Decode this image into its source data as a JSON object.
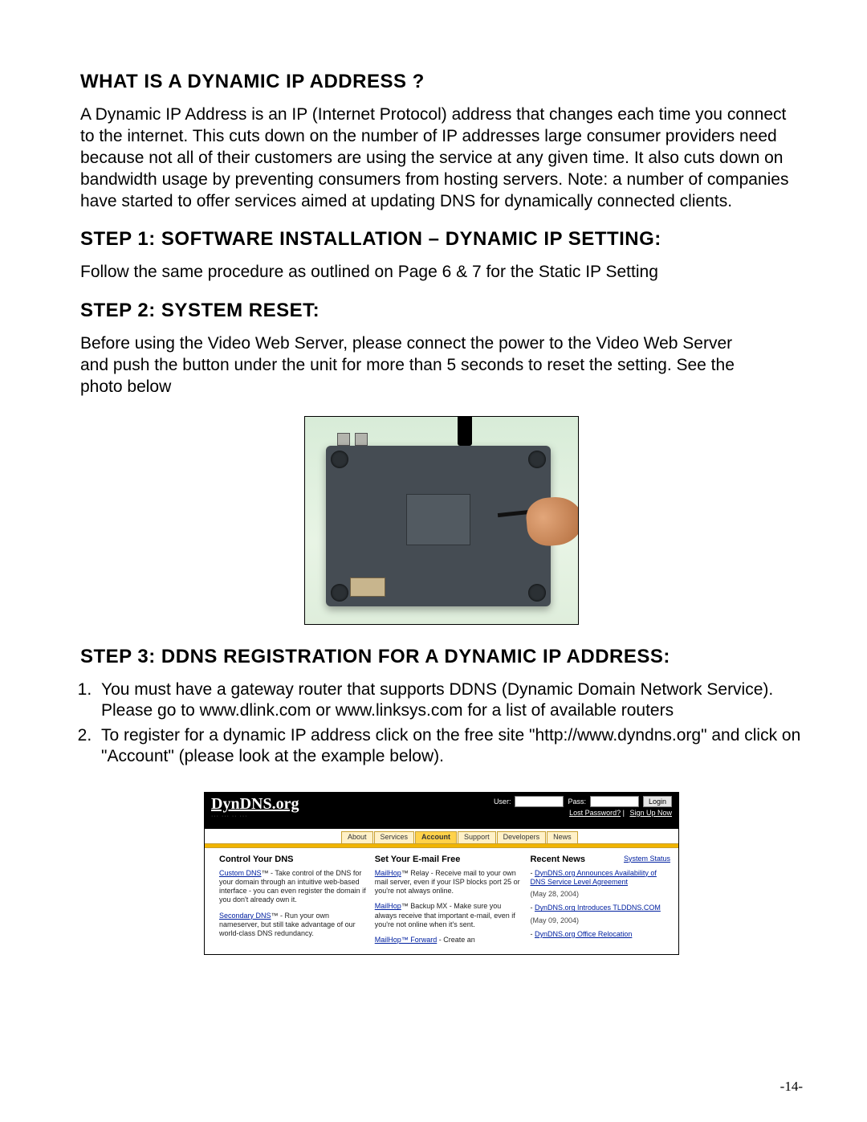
{
  "sections": {
    "what_is": {
      "title": "WHAT IS A DYNAMIC IP ADDRESS ?",
      "body": "A Dynamic IP Address is an IP (Internet Protocol) address that changes each time you connect to the internet. This cuts down on the number of IP addresses large consumer providers need because not all of  their customers are using the service at any given time. It also cuts down on bandwidth usage by preventing consumers from hosting servers. Note:  a number of  companies have started  to offer services aimed at updating DNS for dynamically connected clients."
    },
    "step1": {
      "title": "STEP 1: SOFTWARE INSTALLATION – DYNAMIC IP SETTING:",
      "body": "Follow the same procedure as outlined on Page 6 & 7 for the Static IP Setting"
    },
    "step2": {
      "title": "STEP 2: SYSTEM RESET:",
      "body": "Before using the Video Web Server, please connect the power to the Video Web Server and push the button under the unit for more than 5 seconds to reset the setting. See the photo below"
    },
    "step3": {
      "title": "STEP 3: DDNS REGISTRATION FOR A DYNAMIC IP ADDRESS:",
      "items": [
        "You must have a gateway router that supports DDNS (Dynamic Domain Network Service). Please go to www.dlink.com or www.linksys.com for a list of available routers",
        "To register for a dynamic IP address click on the free site \"http://www.dyndns.org\" and click on \"Account\" (please look at the example below)."
      ]
    }
  },
  "dyndns": {
    "logo": "DynDNS.org",
    "login": {
      "user_label": "User:",
      "pass_label": "Pass:",
      "button": "Login",
      "lost": "Lost Password?",
      "signup": "Sign Up Now"
    },
    "tabs": [
      "About",
      "Services",
      "Account",
      "Support",
      "Developers",
      "News"
    ],
    "active_tab": "Account",
    "col_left": {
      "heading": "Control Your DNS",
      "p1_link": "Custom DNS",
      "p1_rest": "™ - Take control of the DNS for your domain through an intuitive web-based interface - you can even register the domain if you don't already own it.",
      "p2_link": "Secondary DNS",
      "p2_rest": "™ - Run your own nameserver, but still take advantage of our world-class DNS redundancy."
    },
    "col_mid": {
      "heading": "Set Your E-mail Free",
      "p1_link": "MailHop",
      "p1_rest": "™ Relay - Receive mail to your own mail server, even if your ISP blocks port 25 or you're not always online.",
      "p2_link": "MailHop",
      "p2_rest": "™ Backup MX - Make sure you always receive that important e-mail, even if you're not online when it's sent.",
      "p3_link": "MailHop™ Forward",
      "p3_rest": " - Create an"
    },
    "col_right": {
      "heading": "Recent News",
      "status": "System Status",
      "n1_link": "DynDNS.org Announces Availability of DNS Service Level Agreement",
      "n1_date": "(May 28, 2004)",
      "n2_link": "DynDNS.org Introduces TLDDNS.COM",
      "n2_date": "(May 09, 2004)",
      "n3_link": "DynDNS.org Office Relocation"
    }
  },
  "page_number": "-14-"
}
